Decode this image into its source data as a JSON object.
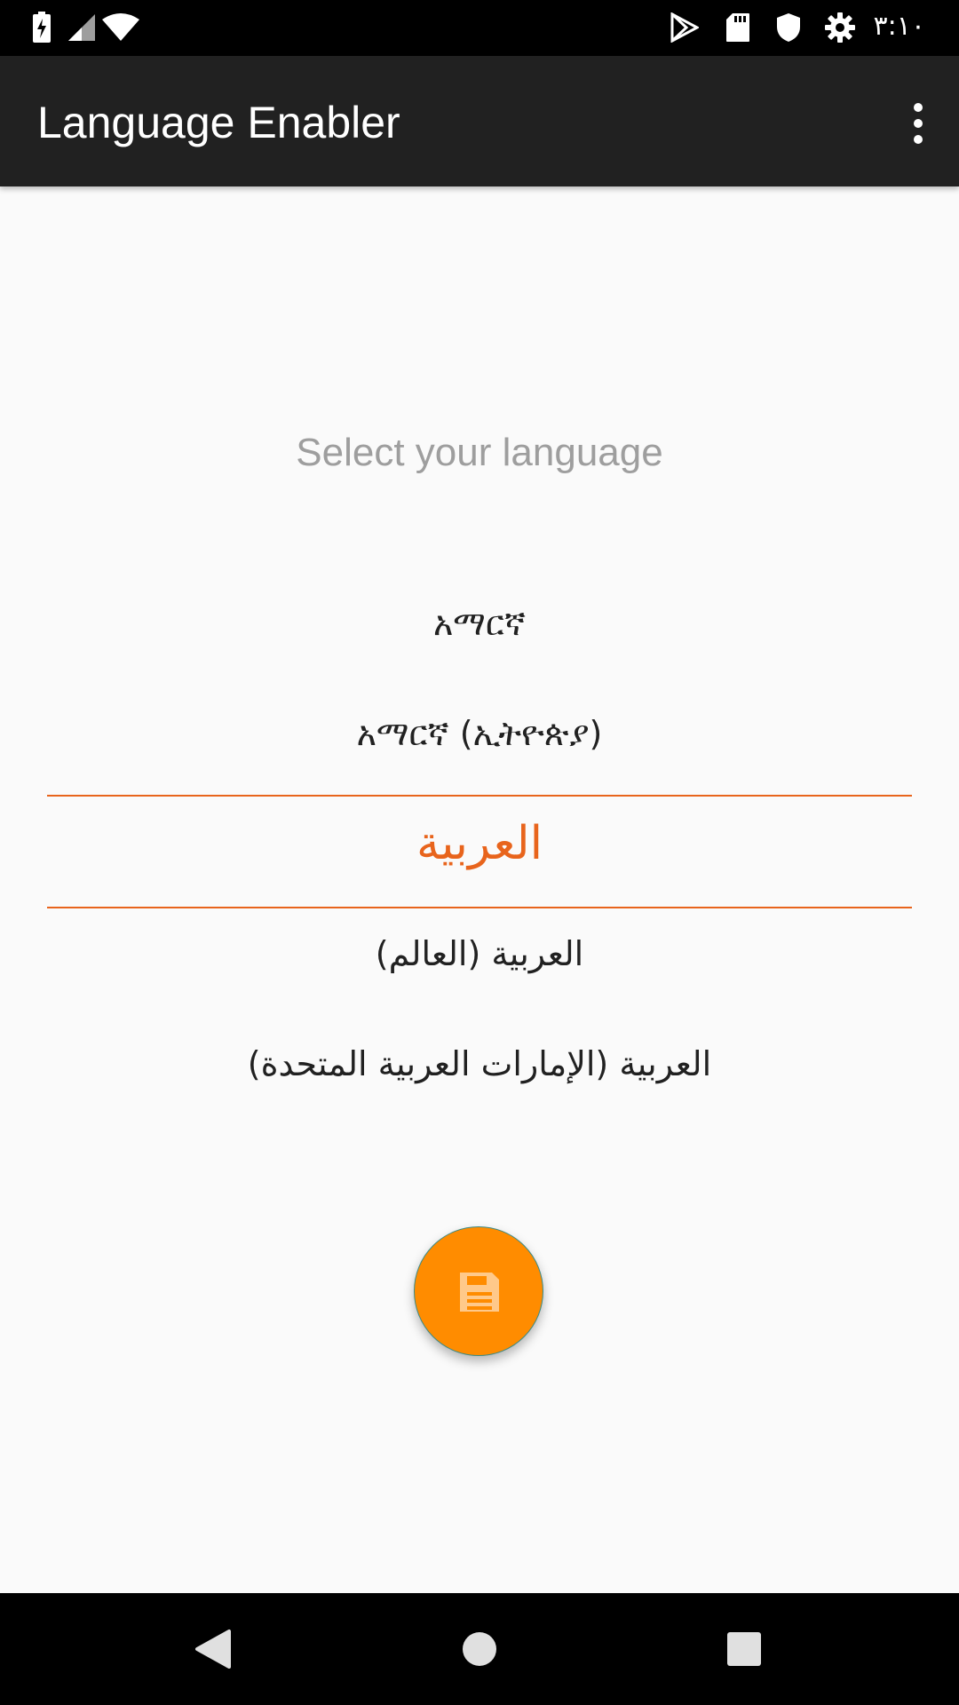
{
  "status_bar": {
    "time": "٣:١٠",
    "icons": [
      "battery-charging-icon",
      "signal-icon",
      "wifi-icon",
      "play-store-icon",
      "sd-card-icon",
      "shield-icon",
      "settings-icon"
    ]
  },
  "app_bar": {
    "title": "Language Enabler",
    "menu_icon": "more-vertical-icon"
  },
  "content": {
    "prompt": "Select your language",
    "languages": [
      "አማርኛ",
      "አማርኛ (ኢትዮጵያ)",
      "العربية",
      "العربية (العالم)",
      "العربية (الإمارات العربية المتحدة)"
    ],
    "selected_index": 2
  },
  "fab": {
    "icon": "save-icon"
  },
  "nav_bar": {
    "icons": [
      "back-icon",
      "home-icon",
      "recents-icon"
    ]
  },
  "colors": {
    "accent": "#e8641c",
    "fab": "#ff8c00",
    "app_bar": "#212121",
    "background": "#fafafa"
  }
}
